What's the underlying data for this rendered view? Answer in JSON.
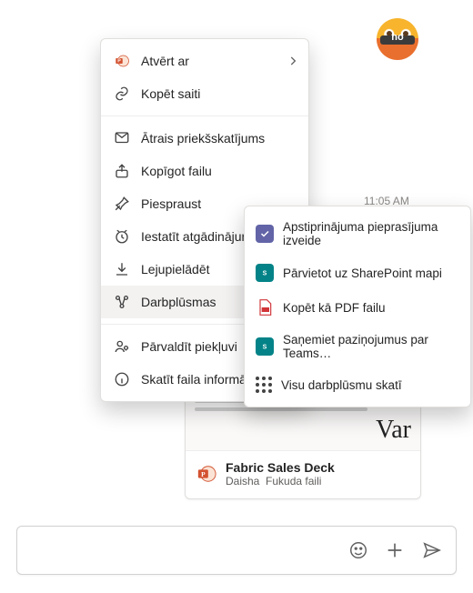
{
  "avatar": {
    "label": "no"
  },
  "timestamp": "11:05 AM",
  "menu": {
    "open_with": "Atvērt ar",
    "copy_link": "Kopēt saiti",
    "quick_preview": "Ātrais priekšskatījums",
    "share_file": "Kopīgot failu",
    "pin": "Piespraust",
    "set_reminder": "Iestatīt atgādinājumu",
    "download": "Lejupielādēt",
    "workflows": "Darbplūsmas",
    "manage_access": "Pārvaldīt piekļuvi",
    "view_file_info": "Skatīt faila informāciju"
  },
  "submenu": {
    "approval": "Apstiprinājuma pieprasījuma izveide",
    "move_sp": "Pārvietot uz SharePoint mapi",
    "copy_pdf": "Kopēt kā PDF failu",
    "teams_notif": "Saņemiet paziņojumus par Teams…",
    "view_all": "Visu darbplūsmu skatī"
  },
  "file": {
    "name": "Fabric Sales Deck",
    "sub_author": "Daisha",
    "sub_loc": "Fukuda faili",
    "preview_word": "Var"
  }
}
